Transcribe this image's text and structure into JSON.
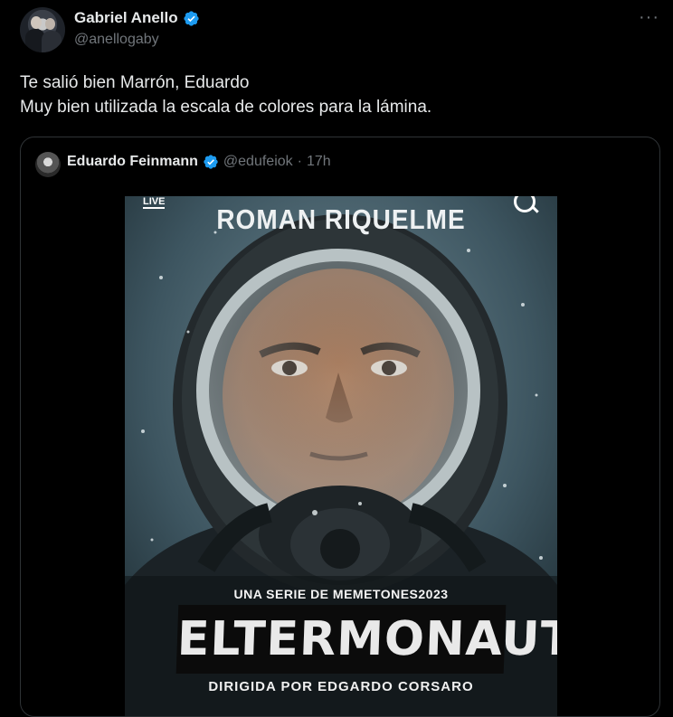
{
  "tweet": {
    "author_name": "Gabriel Anello",
    "author_handle": "@anellogaby",
    "more_icon": "more-dots-icon",
    "lines": [
      "Te salió bien Marrón, Eduardo",
      "Muy bien utilizada la escala de colores para la lámina."
    ]
  },
  "quote": {
    "author_name": "Eduardo Feinmann",
    "author_handle": "@edufeiok",
    "separator": "·",
    "time": "17h"
  },
  "poster": {
    "top_text": "ROMAN RIQUELME",
    "live_label": "LIVE",
    "series_text": "UNA SERIE DE MEMETONES2023",
    "title": "ELTERMONAUTA",
    "director_text": "DIRIGIDA POR EDGARDO CORSARO"
  },
  "colors": {
    "background": "#000000",
    "text_primary": "#e7e9ea",
    "text_secondary": "#71767b",
    "verified_blue": "#1d9bf0",
    "border": "#2f3336"
  }
}
